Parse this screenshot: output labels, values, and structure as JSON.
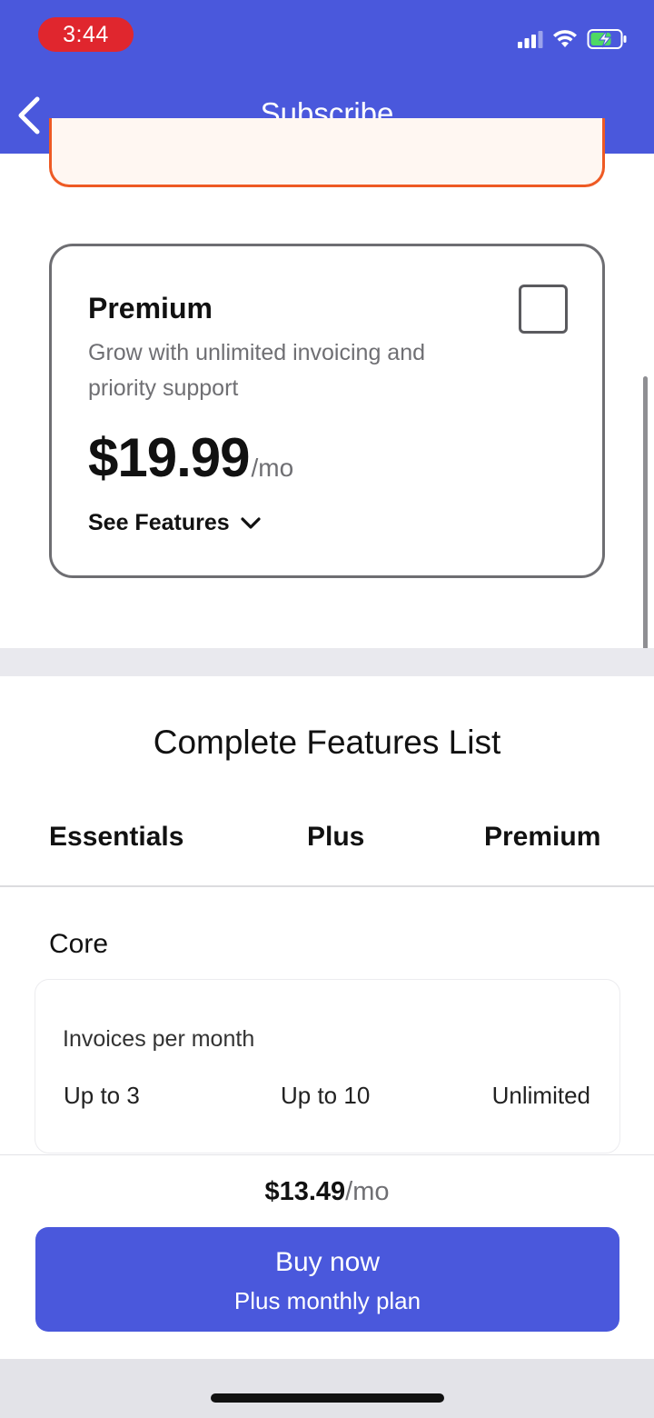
{
  "status_bar": {
    "time": "3:44",
    "icons": [
      "signal-icon",
      "wifi-icon",
      "battery-charging-icon"
    ]
  },
  "header": {
    "title": "Subscribe",
    "back_icon": "chevron-left-icon"
  },
  "plan_card": {
    "name": "Premium",
    "description": "Grow with unlimited invoicing and priority support",
    "price": "$19.99",
    "price_unit": "/mo",
    "see_features": "See Features",
    "selected": false
  },
  "features": {
    "title": "Complete Features List",
    "columns": [
      "Essentials",
      "Plus",
      "Premium"
    ],
    "section": "Core",
    "rows": [
      {
        "name": "Invoices per month",
        "values": [
          "Up to 3",
          "Up to 10",
          "Unlimited"
        ]
      }
    ]
  },
  "purchase": {
    "price": "$13.49",
    "price_unit": "/mo",
    "button_label": "Buy now",
    "button_sublabel": "Plus monthly plan"
  },
  "colors": {
    "brand": "#4a58dc",
    "alert_border": "#ee5a24",
    "time_pill": "#e0262e"
  }
}
